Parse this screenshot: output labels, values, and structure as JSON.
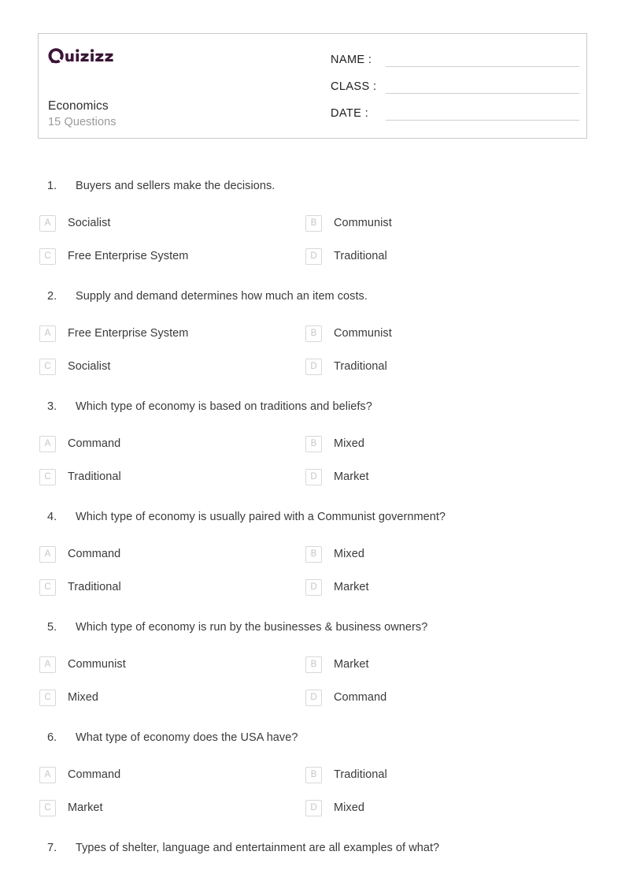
{
  "brand": {
    "logo_text": "Quizizz",
    "logo_color": "#3B1537"
  },
  "header": {
    "quiz_title": "Economics",
    "question_count_label": "15 Questions",
    "fields": [
      {
        "label": "NAME :",
        "value": ""
      },
      {
        "label": "CLASS :",
        "value": ""
      },
      {
        "label": "DATE  :",
        "value": ""
      }
    ]
  },
  "questions": [
    {
      "number": "1.",
      "text": "Buyers and sellers make the decisions.",
      "options": [
        {
          "letter": "A",
          "text": "Socialist"
        },
        {
          "letter": "B",
          "text": "Communist"
        },
        {
          "letter": "C",
          "text": "Free Enterprise System"
        },
        {
          "letter": "D",
          "text": "Traditional"
        }
      ]
    },
    {
      "number": "2.",
      "text": "Supply and demand determines how much an item costs.",
      "options": [
        {
          "letter": "A",
          "text": "Free Enterprise System"
        },
        {
          "letter": "B",
          "text": "Communist"
        },
        {
          "letter": "C",
          "text": "Socialist"
        },
        {
          "letter": "D",
          "text": "Traditional"
        }
      ]
    },
    {
      "number": "3.",
      "text": "Which type of economy is based on traditions and beliefs?",
      "options": [
        {
          "letter": "A",
          "text": "Command"
        },
        {
          "letter": "B",
          "text": "Mixed"
        },
        {
          "letter": "C",
          "text": "Traditional"
        },
        {
          "letter": "D",
          "text": "Market"
        }
      ]
    },
    {
      "number": "4.",
      "text": "Which type of economy is usually paired with a Communist government?",
      "options": [
        {
          "letter": "A",
          "text": "Command"
        },
        {
          "letter": "B",
          "text": "Mixed"
        },
        {
          "letter": "C",
          "text": "Traditional"
        },
        {
          "letter": "D",
          "text": "Market"
        }
      ]
    },
    {
      "number": "5.",
      "text": "Which type of economy is run by the businesses & business owners?",
      "options": [
        {
          "letter": "A",
          "text": "Communist"
        },
        {
          "letter": "B",
          "text": "Market"
        },
        {
          "letter": "C",
          "text": "Mixed"
        },
        {
          "letter": "D",
          "text": "Command"
        }
      ]
    },
    {
      "number": "6.",
      "text": "What type of economy does the USA have?",
      "options": [
        {
          "letter": "A",
          "text": "Command"
        },
        {
          "letter": "B",
          "text": "Traditional"
        },
        {
          "letter": "C",
          "text": "Market"
        },
        {
          "letter": "D",
          "text": "Mixed"
        }
      ]
    },
    {
      "number": "7.",
      "text": "Types of shelter, language and entertainment are all examples of what?",
      "options": []
    }
  ]
}
